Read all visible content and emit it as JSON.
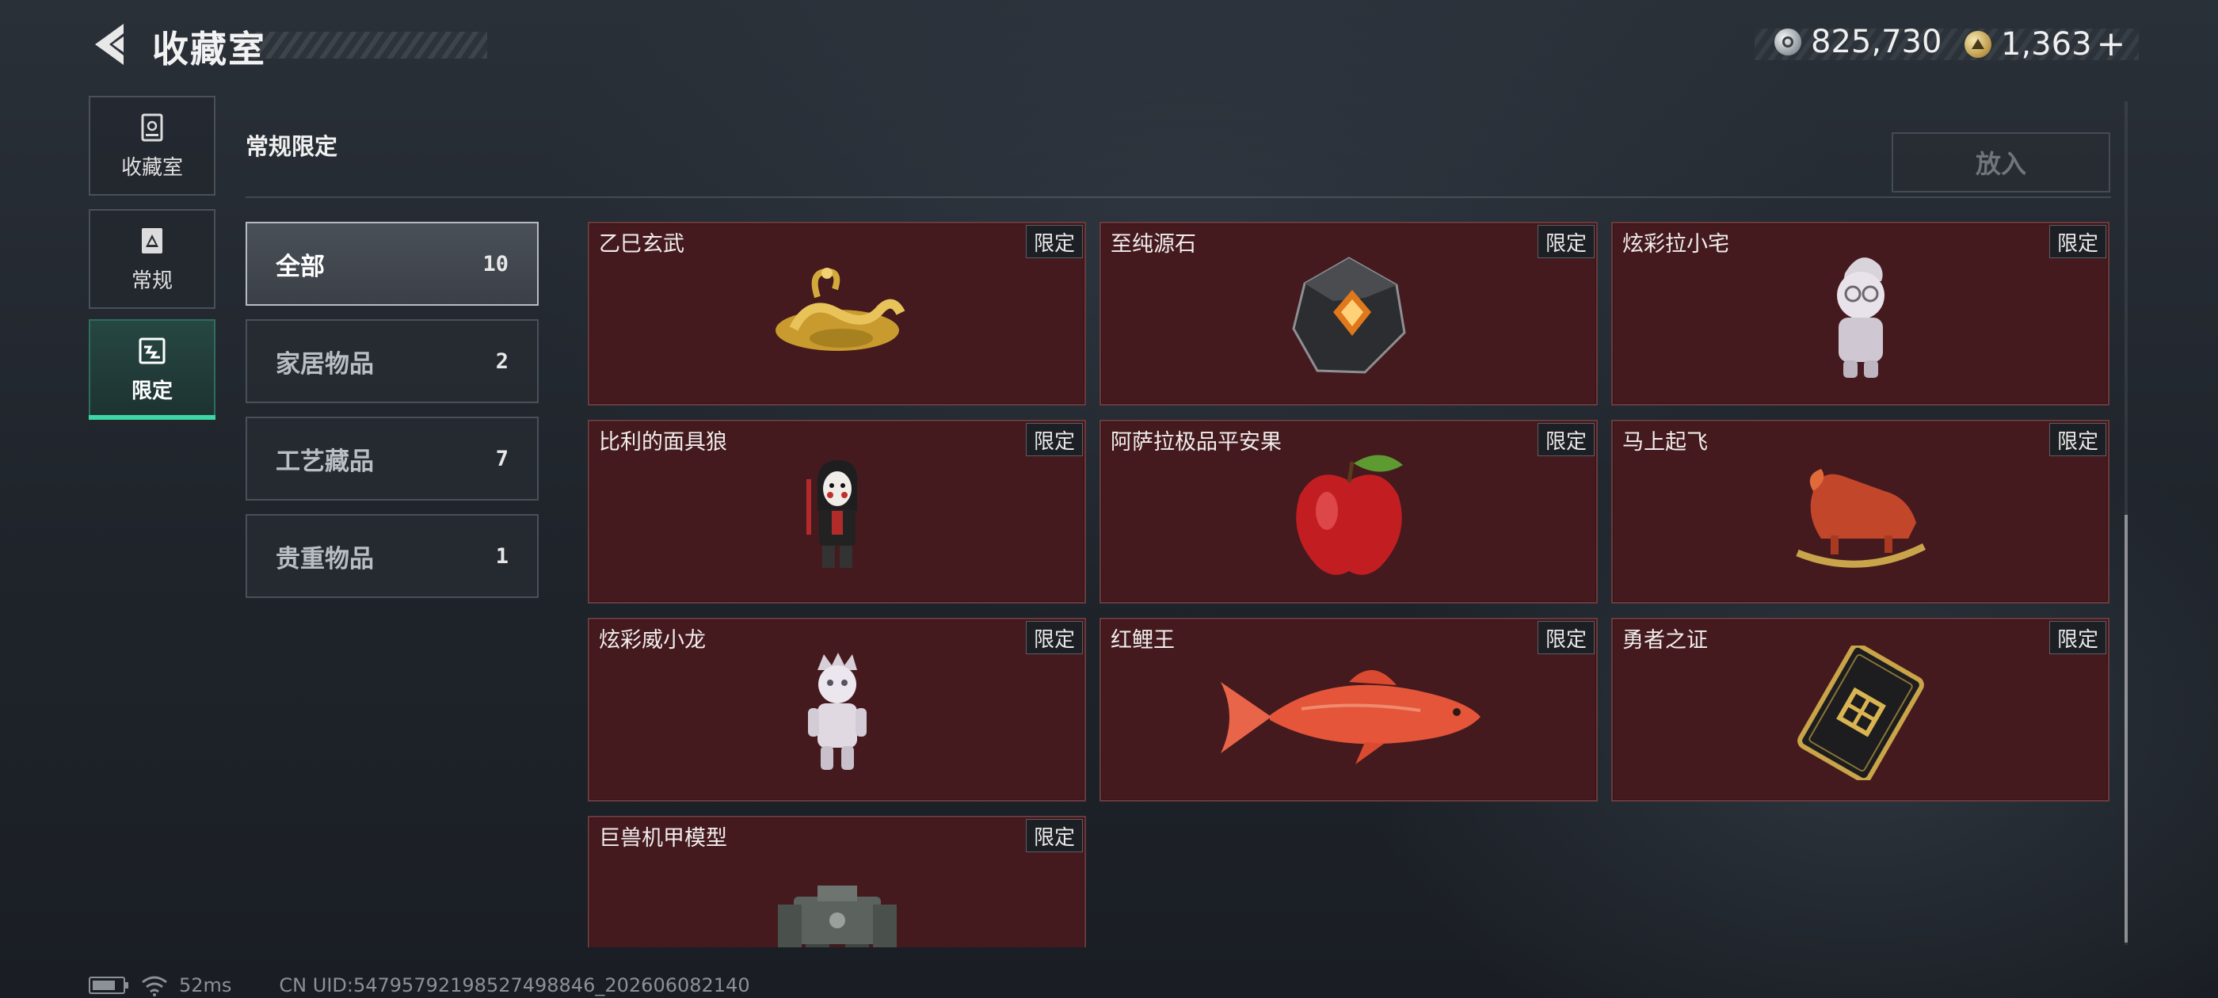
{
  "header": {
    "title": "收藏室",
    "currencies": [
      {
        "icon": "silver-coin-icon",
        "value": "825,730"
      },
      {
        "icon": "gold-coin-icon",
        "value": "1,363",
        "plus": "+"
      }
    ]
  },
  "rail": [
    {
      "label": "收藏室",
      "icon": "collection-room-icon",
      "active": false
    },
    {
      "label": "常规",
      "icon": "regular-icon",
      "active": false
    },
    {
      "label": "限定",
      "icon": "limited-icon",
      "active": true
    }
  ],
  "section": {
    "title": "常规限定",
    "place_button": "放入"
  },
  "filters": [
    {
      "name": "全部",
      "count": "10",
      "active": true
    },
    {
      "name": "家居物品",
      "count": "2",
      "active": false
    },
    {
      "name": "工艺藏品",
      "count": "7",
      "active": false
    },
    {
      "name": "贵重物品",
      "count": "1",
      "active": false
    }
  ],
  "items": [
    {
      "name": "乙巳玄武",
      "tag": "限定",
      "art": "golden-dragon-icon"
    },
    {
      "name": "至纯源石",
      "tag": "限定",
      "art": "source-stone-icon"
    },
    {
      "name": "炫彩拉小宅",
      "tag": "限定",
      "art": "figurine-icon"
    },
    {
      "name": "比利的面具狼",
      "tag": "限定",
      "art": "puppet-figure-icon"
    },
    {
      "name": "阿萨拉极品平安果",
      "tag": "限定",
      "art": "red-apple-icon"
    },
    {
      "name": "马上起飞",
      "tag": "限定",
      "art": "rocking-horse-icon"
    },
    {
      "name": "炫彩威小龙",
      "tag": "限定",
      "art": "doll-figure-icon"
    },
    {
      "name": "红鲤王",
      "tag": "限定",
      "art": "red-carp-icon"
    },
    {
      "name": "勇者之证",
      "tag": "限定",
      "art": "badge-card-icon"
    },
    {
      "name": "巨兽机甲模型",
      "tag": "限定",
      "art": "mech-model-icon"
    }
  ],
  "status": {
    "ping": "52ms",
    "uid": "CN UID:5479579219852749884​6_202606082140"
  }
}
